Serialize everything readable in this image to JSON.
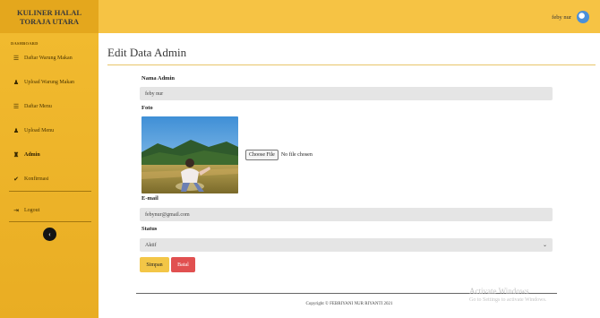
{
  "brand": {
    "line1": "KULINER HALAL",
    "line2": "TORAJA UTARA"
  },
  "header": {
    "user_name": "feby nur"
  },
  "sidebar": {
    "heading": "DASHBOARD",
    "items": [
      {
        "label": "Daftar Warung Makan",
        "icon": "list-icon"
      },
      {
        "label": "Upload Warung Makan",
        "icon": "user-icon"
      },
      {
        "label": "Daftar Menu",
        "icon": "list-icon"
      },
      {
        "label": "Upload Menu",
        "icon": "user-icon"
      },
      {
        "label": "Admin",
        "icon": "user-group-icon"
      },
      {
        "label": "Konfirmasi",
        "icon": "check-icon"
      },
      {
        "label": "Logout",
        "icon": "logout-icon"
      }
    ],
    "toggle": "‹"
  },
  "main": {
    "title": "Edit Data Admin",
    "form": {
      "name_label": "Nama Admin",
      "name_value": "feby nur",
      "photo_label": "Foto",
      "file_button": "Choose File",
      "file_status": "No file chosen",
      "email_label": "E-mail",
      "email_value": "febynur@gmail.com",
      "status_label": "Status",
      "status_value": "Aktif",
      "save_button": "Simpan",
      "cancel_button": "Batal"
    }
  },
  "footer": {
    "copyright": "Copyright © FEBRIYANI NUR RIYANTI 2021"
  },
  "watermark": {
    "line1": "Activate Windows",
    "line2": "Go to Settings to activate Windows."
  },
  "colors": {
    "accent": "#f6c344",
    "sidebar": "#eeb42a",
    "danger": "#e15050"
  }
}
